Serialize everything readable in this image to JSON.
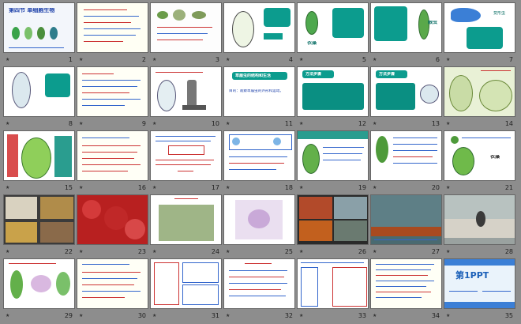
{
  "slides": [
    {
      "num": "1",
      "title": "第四节 单细胞生物"
    },
    {
      "num": "2"
    },
    {
      "num": "3"
    },
    {
      "num": "4"
    },
    {
      "num": "5"
    },
    {
      "num": "6"
    },
    {
      "num": "7"
    },
    {
      "num": "8"
    },
    {
      "num": "9"
    },
    {
      "num": "10"
    },
    {
      "num": "11"
    },
    {
      "num": "12"
    },
    {
      "num": "13"
    },
    {
      "num": "14"
    },
    {
      "num": "15"
    },
    {
      "num": "16"
    },
    {
      "num": "17"
    },
    {
      "num": "18"
    },
    {
      "num": "19"
    },
    {
      "num": "20"
    },
    {
      "num": "21"
    },
    {
      "num": "22"
    },
    {
      "num": "23"
    },
    {
      "num": "24"
    },
    {
      "num": "25"
    },
    {
      "num": "26"
    },
    {
      "num": "27"
    },
    {
      "num": "28"
    },
    {
      "num": "29"
    },
    {
      "num": "30"
    },
    {
      "num": "31"
    },
    {
      "num": "32"
    },
    {
      "num": "33"
    },
    {
      "num": "34"
    },
    {
      "num": "35"
    }
  ],
  "labels": {
    "s5_caption": "衣藻",
    "s6_caption": "眼虫",
    "s7_caption": "变形虫",
    "s11_title": "草履虫的结构和生活",
    "s11_goal": "目的：观察草履虫的外形和运动。",
    "s12_title": "方法步骤",
    "s13_title": "方法步骤",
    "s21_caption": "衣藻",
    "s35_logo": "第1PPT"
  },
  "colors": {
    "teal": "#0c9c8e",
    "dark_teal": "#0a6f66",
    "sky": "#3b7fd6",
    "red": "#cc2a2a",
    "green": "#2f9c3a"
  }
}
